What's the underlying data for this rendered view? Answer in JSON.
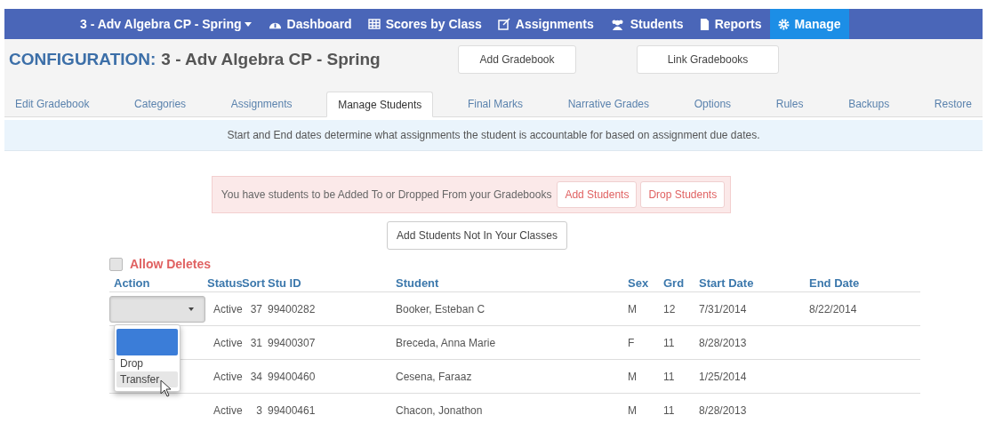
{
  "nav": {
    "class_menu": {
      "label": "3 - Adv Algebra CP - Spring"
    },
    "items": [
      {
        "label": "Dashboard",
        "kind": "dashboard",
        "selected": false
      },
      {
        "label": "Scores by Class",
        "kind": "grid",
        "selected": false
      },
      {
        "label": "Assignments",
        "kind": "edit",
        "selected": false
      },
      {
        "label": "Students",
        "kind": "users",
        "selected": false
      },
      {
        "label": "Reports",
        "kind": "file",
        "selected": false
      },
      {
        "label": "Manage",
        "kind": "gear",
        "selected": true
      }
    ]
  },
  "header": {
    "label": "CONFIGURATION:",
    "course": "3 - Adv Algebra CP - Spring",
    "buttons": [
      "Add Gradebook",
      "Link Gradebooks"
    ]
  },
  "tabs": [
    {
      "label": "Edit Gradebook",
      "selected": false
    },
    {
      "label": "Categories",
      "selected": false
    },
    {
      "label": "Assignments",
      "selected": false
    },
    {
      "label": "Manage Students",
      "selected": true
    },
    {
      "label": "Final Marks",
      "selected": false
    },
    {
      "label": "Narrative Grades",
      "selected": false
    },
    {
      "label": "Options",
      "selected": false
    },
    {
      "label": "Rules",
      "selected": false
    },
    {
      "label": "Backups",
      "selected": false
    },
    {
      "label": "Restore",
      "selected": false
    }
  ],
  "info": "Start and End dates determine what assignments the student is accountable for based on assignment due dates.",
  "alert": {
    "text": "You have students to be Added To or Dropped From your Gradebooks",
    "buttons": [
      "Add Students",
      "Drop Students"
    ]
  },
  "add_button": "Add Students Not In Your Classes",
  "allow_deletes": {
    "label": "Allow Deletes",
    "checked": false
  },
  "table": {
    "columns": [
      "Action",
      "Status",
      "Sort",
      "Stu ID",
      "Student",
      "Sex",
      "Grd",
      "Start Date",
      "End Date"
    ],
    "action_select": {
      "expanded": true,
      "options": [
        {
          "selected": true
        },
        {
          "label": "Drop",
          "selected": false,
          "hovered": false
        },
        {
          "label": "Transfer",
          "selected": false,
          "hovered": true
        }
      ]
    },
    "rows": [
      {
        "status": "Active",
        "sort": "37",
        "stu_id": "99400282",
        "student": "Booker, Esteban C",
        "sex": "M",
        "grd": "12",
        "start_date": "7/31/2014",
        "end_date": "8/22/2014"
      },
      {
        "status": "Active",
        "sort": "31",
        "stu_id": "99400307",
        "student": "Breceda, Anna Marie",
        "sex": "F",
        "grd": "11",
        "start_date": "8/28/2013"
      },
      {
        "status": "Active",
        "sort": "34",
        "stu_id": "99400460",
        "student": "Cesena, Faraaz",
        "sex": "M",
        "grd": "11",
        "start_date": "1/25/2014"
      },
      {
        "status": "Active",
        "sort": "3",
        "stu_id": "99400461",
        "student": "Chacon, Jonathon",
        "sex": "M",
        "grd": "11",
        "start_date": "8/28/2013"
      }
    ]
  }
}
